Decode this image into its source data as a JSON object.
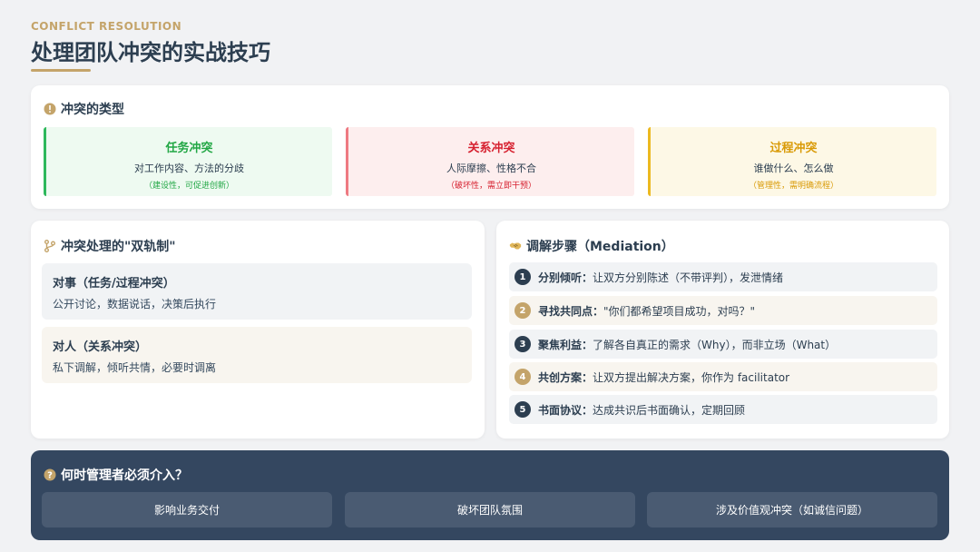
{
  "header": {
    "eyebrow": "CONFLICT RESOLUTION",
    "title": "处理团队冲突的实战技巧"
  },
  "types": {
    "title": "冲突的类型",
    "items": [
      {
        "name": "任务冲突",
        "desc": "对工作内容、方法的分歧",
        "note": "（建设性，可促进创新）",
        "color": "#22a745",
        "bg": "#eefaf1",
        "border": "#2eb85c"
      },
      {
        "name": "关系冲突",
        "desc": "人际摩擦、性格不合",
        "note": "（破坏性，需立即干预）",
        "color": "#d6202f",
        "bg": "#fdeeee",
        "border": "#ee7a82"
      },
      {
        "name": "过程冲突",
        "desc": "谁做什么、怎么做",
        "note": "（管理性，需明确流程）",
        "color": "#d99a06",
        "bg": "#fdf8e6",
        "border": "#ecb920"
      }
    ]
  },
  "dual": {
    "title": "冲突处理的\"双轨制\"",
    "tracks": [
      {
        "title": "对事（任务/过程冲突）",
        "desc": "公开讨论，数据说话，决策后执行",
        "bg": "#f1f3f5"
      },
      {
        "title": "对人（关系冲突）",
        "desc": "私下调解，倾听共情，必要时调离",
        "bg": "#f8f5ef"
      }
    ]
  },
  "mediation": {
    "title": "调解步骤（Mediation）",
    "steps": [
      {
        "num": "1",
        "label": "分别倾听：",
        "text": "让双方分别陈述（不带评判），发泄情绪",
        "badge": "#2c3e50",
        "bg": "#f1f3f5"
      },
      {
        "num": "2",
        "label": "寻找共同点：",
        "text": "\"你们都希望项目成功，对吗？\"",
        "badge": "#c4a46a",
        "bg": "#f8f5ef"
      },
      {
        "num": "3",
        "label": "聚焦利益：",
        "text": "了解各自真正的需求（Why），而非立场（What）",
        "badge": "#2c3e50",
        "bg": "#f1f3f5"
      },
      {
        "num": "4",
        "label": "共创方案：",
        "text": "让双方提出解决方案，你作为 facilitator",
        "badge": "#c4a46a",
        "bg": "#f8f5ef"
      },
      {
        "num": "5",
        "label": "书面协议：",
        "text": "达成共识后书面确认，定期回顾",
        "badge": "#2c3e50",
        "bg": "#f1f3f5"
      }
    ]
  },
  "when": {
    "title": "何时管理者必须介入？",
    "items": [
      "影响业务交付",
      "破坏团队氛围",
      "涉及价值观冲突（如诚信问题）"
    ]
  },
  "colors": {
    "accent": "#c4a46a",
    "navy": "#2c3e50",
    "dark_panel": "#344760"
  },
  "icons": {
    "types": "exclamation-circle-icon",
    "dual": "branch-icon",
    "mediation": "handshake-icon",
    "when": "question-circle-icon"
  }
}
